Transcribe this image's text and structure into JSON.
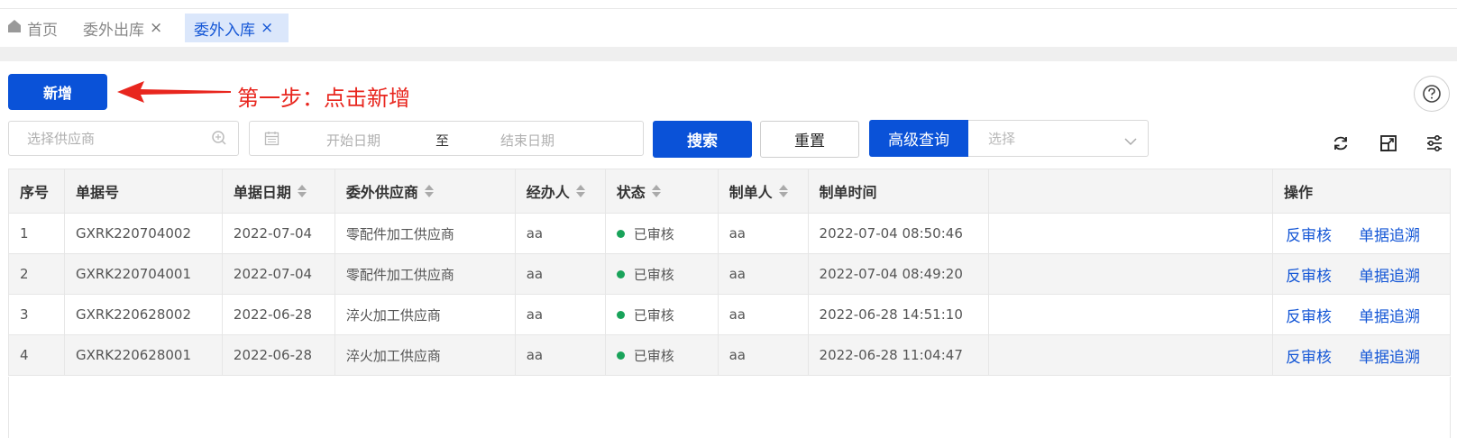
{
  "tabs": {
    "home": "首页",
    "outbound": "委外出库",
    "inbound": "委外入库",
    "close": "×"
  },
  "toolbar": {
    "add_label": "新增",
    "annotation": "第一步：点击新增",
    "annotation_color": "#e8261e"
  },
  "filters": {
    "supplier_placeholder": "选择供应商",
    "start_date_placeholder": "开始日期",
    "to_label": "至",
    "end_date_placeholder": "结束日期",
    "search_label": "搜索",
    "reset_label": "重置",
    "advanced_label": "高级查询",
    "select_placeholder": "选择"
  },
  "colors": {
    "primary": "#0a52d8",
    "status_ok": "#19a35a",
    "link": "#1557d6"
  },
  "table": {
    "headers": {
      "index": "序号",
      "doc_no": "单据号",
      "doc_date": "单据日期",
      "supplier": "委外供应商",
      "handler": "经办人",
      "status": "状态",
      "creator": "制单人",
      "created_at": "制单时间",
      "actions": "操作"
    },
    "rows": [
      {
        "index": "1",
        "doc_no": "GXRK220704002",
        "doc_date": "2022-07-04",
        "supplier": "零配件加工供应商",
        "handler": "aa",
        "status": "已审核",
        "creator": "aa",
        "created_at": "2022-07-04 08:50:46",
        "action1": "反审核",
        "action2": "单据追溯"
      },
      {
        "index": "2",
        "doc_no": "GXRK220704001",
        "doc_date": "2022-07-04",
        "supplier": "零配件加工供应商",
        "handler": "aa",
        "status": "已审核",
        "creator": "aa",
        "created_at": "2022-07-04 08:49:20",
        "action1": "反审核",
        "action2": "单据追溯"
      },
      {
        "index": "3",
        "doc_no": "GXRK220628002",
        "doc_date": "2022-06-28",
        "supplier": "淬火加工供应商",
        "handler": "aa",
        "status": "已审核",
        "creator": "aa",
        "created_at": "2022-06-28 14:51:10",
        "action1": "反审核",
        "action2": "单据追溯"
      },
      {
        "index": "4",
        "doc_no": "GXRK220628001",
        "doc_date": "2022-06-28",
        "supplier": "淬火加工供应商",
        "handler": "aa",
        "status": "已审核",
        "creator": "aa",
        "created_at": "2022-06-28 11:04:47",
        "action1": "反审核",
        "action2": "单据追溯"
      }
    ]
  }
}
